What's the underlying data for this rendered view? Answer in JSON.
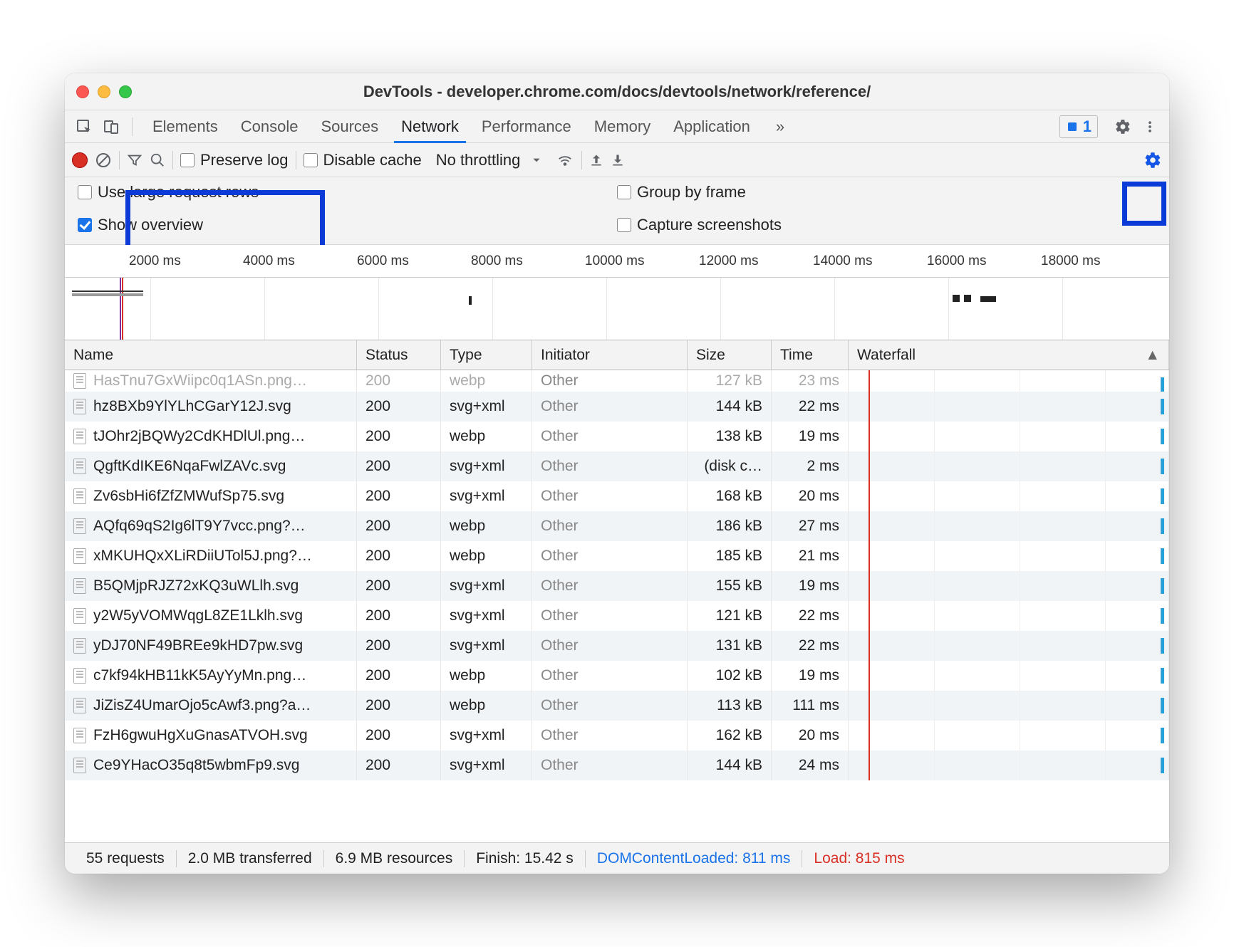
{
  "title": "DevTools - developer.chrome.com/docs/devtools/network/reference/",
  "tabs": [
    "Elements",
    "Console",
    "Sources",
    "Network",
    "Performance",
    "Memory",
    "Application"
  ],
  "active_tab": "Network",
  "issues_count": "1",
  "toolbar": {
    "preserve_log": "Preserve log",
    "disable_cache": "Disable cache",
    "throttling": "No throttling"
  },
  "settings": {
    "large_rows": "Use large request rows",
    "group_frame": "Group by frame",
    "show_overview": "Show overview",
    "capture_ss": "Capture screenshots"
  },
  "ruler": [
    "2000 ms",
    "4000 ms",
    "6000 ms",
    "8000 ms",
    "10000 ms",
    "12000 ms",
    "14000 ms",
    "16000 ms",
    "18000 ms"
  ],
  "columns": {
    "name": "Name",
    "status": "Status",
    "type": "Type",
    "initiator": "Initiator",
    "size": "Size",
    "time": "Time",
    "waterfall": "Waterfall"
  },
  "rows": [
    {
      "name": "HasTnu7GxWiipc0q1ASn.png…",
      "status": "200",
      "type": "webp",
      "initiator": "Other",
      "size": "127 kB",
      "time": "23 ms",
      "cut": true
    },
    {
      "name": "hz8BXb9YlYLhCGarY12J.svg",
      "status": "200",
      "type": "svg+xml",
      "initiator": "Other",
      "size": "144 kB",
      "time": "22 ms"
    },
    {
      "name": "tJOhr2jBQWy2CdKHDlUl.png…",
      "status": "200",
      "type": "webp",
      "initiator": "Other",
      "size": "138 kB",
      "time": "19 ms"
    },
    {
      "name": "QgftKdIKE6NqaFwlZAVc.svg",
      "status": "200",
      "type": "svg+xml",
      "initiator": "Other",
      "size": "(disk c…",
      "time": "2 ms"
    },
    {
      "name": "Zv6sbHi6fZfZMWufSp75.svg",
      "status": "200",
      "type": "svg+xml",
      "initiator": "Other",
      "size": "168 kB",
      "time": "20 ms"
    },
    {
      "name": "AQfq69qS2Ig6lT9Y7vcc.png?…",
      "status": "200",
      "type": "webp",
      "initiator": "Other",
      "size": "186 kB",
      "time": "27 ms"
    },
    {
      "name": "xMKUHQxXLiRDiiUTol5J.png?…",
      "status": "200",
      "type": "webp",
      "initiator": "Other",
      "size": "185 kB",
      "time": "21 ms"
    },
    {
      "name": "B5QMjpRJZ72xKQ3uWLlh.svg",
      "status": "200",
      "type": "svg+xml",
      "initiator": "Other",
      "size": "155 kB",
      "time": "19 ms"
    },
    {
      "name": "y2W5yVOMWqgL8ZE1Lklh.svg",
      "status": "200",
      "type": "svg+xml",
      "initiator": "Other",
      "size": "121 kB",
      "time": "22 ms"
    },
    {
      "name": "yDJ70NF49BREe9kHD7pw.svg",
      "status": "200",
      "type": "svg+xml",
      "initiator": "Other",
      "size": "131 kB",
      "time": "22 ms"
    },
    {
      "name": "c7kf94kHB11kK5AyYyMn.png…",
      "status": "200",
      "type": "webp",
      "initiator": "Other",
      "size": "102 kB",
      "time": "19 ms"
    },
    {
      "name": "JiZisZ4UmarOjo5cAwf3.png?a…",
      "status": "200",
      "type": "webp",
      "initiator": "Other",
      "size": "113 kB",
      "time": "111 ms"
    },
    {
      "name": "FzH6gwuHgXuGnasATVOH.svg",
      "status": "200",
      "type": "svg+xml",
      "initiator": "Other",
      "size": "162 kB",
      "time": "20 ms"
    },
    {
      "name": "Ce9YHacO35q8t5wbmFp9.svg",
      "status": "200",
      "type": "svg+xml",
      "initiator": "Other",
      "size": "144 kB",
      "time": "24 ms"
    }
  ],
  "status": {
    "requests": "55 requests",
    "transferred": "2.0 MB transferred",
    "resources": "6.9 MB resources",
    "finish": "Finish: 15.42 s",
    "dcl": "DOMContentLoaded: 811 ms",
    "load": "Load: 815 ms"
  }
}
